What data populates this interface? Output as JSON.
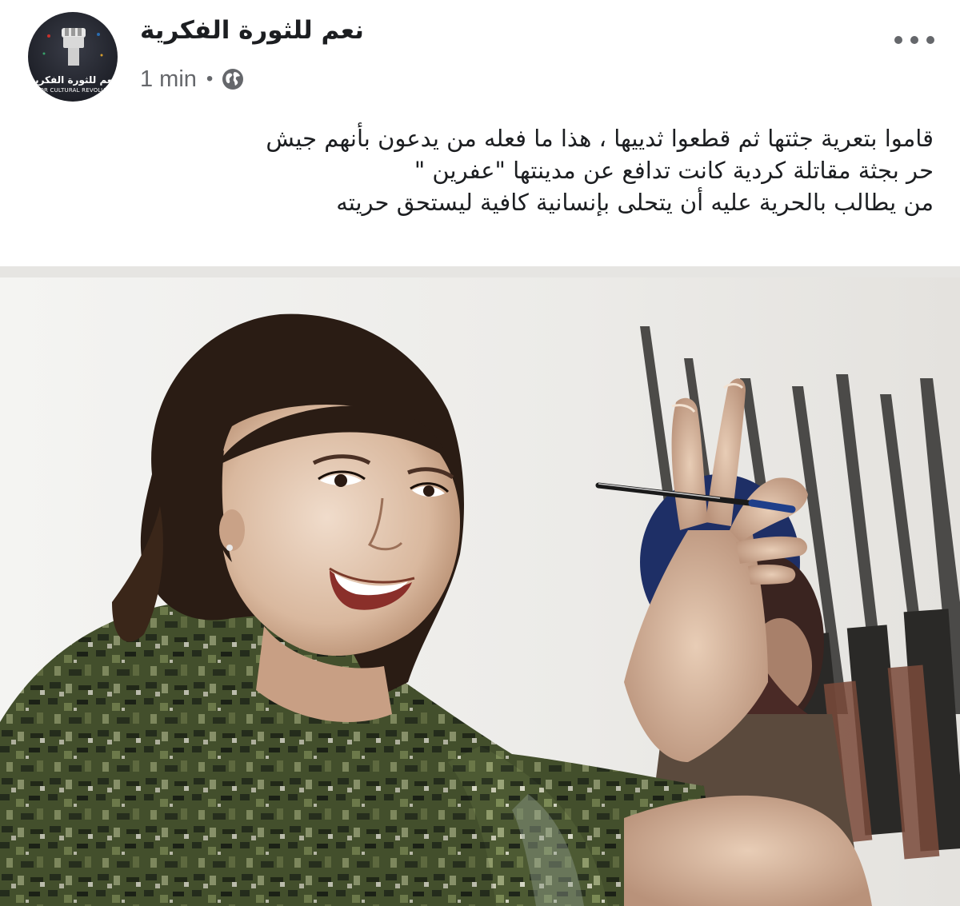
{
  "post": {
    "page_name": "نعم للثورة الفكرية",
    "timestamp": "1 min",
    "separator": "•",
    "privacy_icon": "globe-icon",
    "more_icon": "more-options-icon",
    "avatar": {
      "caption": "نعم للثورة الفكرية",
      "subcaption": "S FOR CULTURAL REVOLUTIO"
    },
    "text_lines": [
      "قاموا بتعرية جثتها ثم قطعوا ثدييها ، هذا ما فعله من يدعون بأنهم جيش",
      "حر بجثة مقاتلة كردية كانت تدافع عن مدينتها \"عفرين \"",
      "من يطالب بالحرية عليه أن يتحلى بإنسانية كافية ليستحق حريته"
    ]
  },
  "colors": {
    "text_primary": "#1c1e21",
    "text_secondary": "#65676b",
    "background": "#ffffff",
    "camo_dark": "#2f3a22",
    "camo_mid": "#5a6a3a"
  }
}
